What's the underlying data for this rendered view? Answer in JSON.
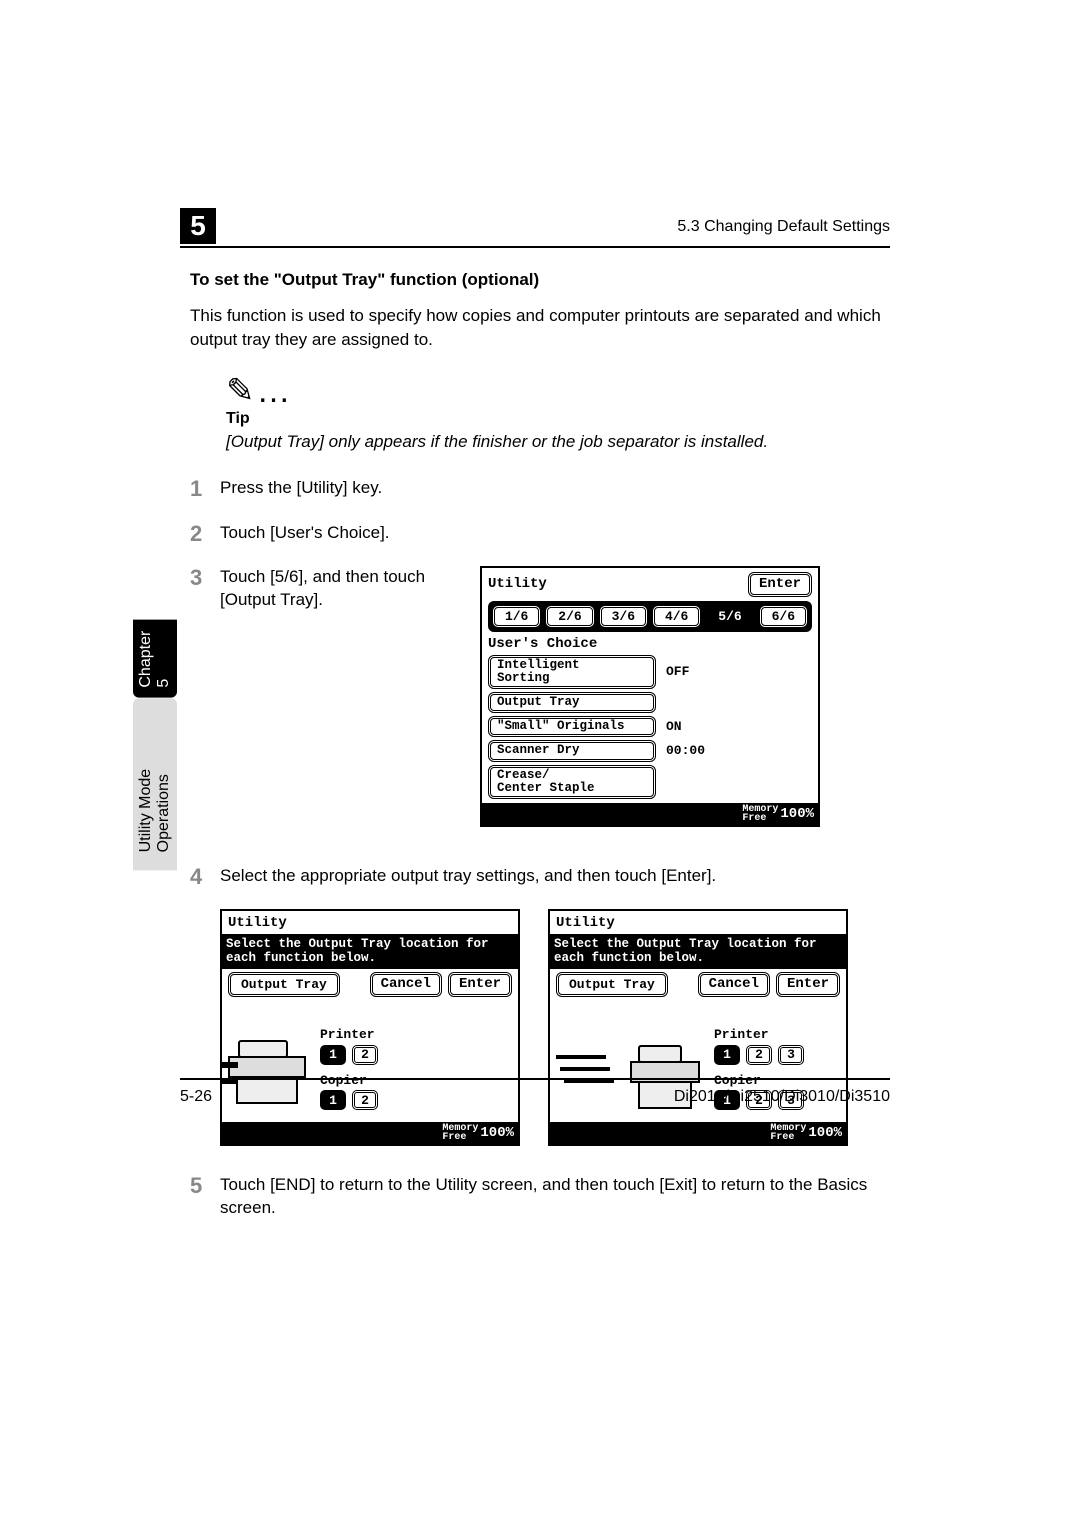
{
  "header": {
    "chapter_num": "5",
    "section": "5.3 Changing Default Settings"
  },
  "vtab": {
    "top": "Chapter 5",
    "bottom": "Utility Mode Operations"
  },
  "h2": "To set the \"Output Tray\" function (optional)",
  "intro": "This function is used to specify how copies and computer printouts are separated and which output tray they are assigned to.",
  "tip": {
    "icon": "✎…",
    "label": "Tip",
    "text": "[Output Tray] only appears if the finisher or the job separator is installed."
  },
  "steps": {
    "s1": {
      "num": "1",
      "text": "Press the [Utility] key."
    },
    "s2": {
      "num": "2",
      "text": "Touch [User's Choice]."
    },
    "s3": {
      "num": "3",
      "text": "Touch [5/6], and then touch [Output Tray]."
    },
    "s4": {
      "num": "4",
      "text": "Select the appropriate output tray settings, and then touch [Enter]."
    },
    "s5": {
      "num": "5",
      "text": "Touch [END] to return to the Utility screen, and then touch [Exit] to return to the Basics screen."
    }
  },
  "lcd1": {
    "title": "Utility",
    "enter": "Enter",
    "tabs": [
      "1/6",
      "2/6",
      "3/6",
      "4/6",
      "5/6",
      "6/6"
    ],
    "selected_tab_index": 4,
    "uc_label": "User's Choice",
    "options": [
      {
        "label": "Intelligent\nSorting",
        "value": "OFF"
      },
      {
        "label": "Output Tray",
        "value": ""
      },
      {
        "label": "\"Small\" Originals",
        "value": "ON"
      },
      {
        "label": "Scanner Dry",
        "value": "00:00"
      },
      {
        "label": "Crease/\nCenter Staple",
        "value": ""
      }
    ],
    "memory_label": "Memory\nFree",
    "memory_value": "100%"
  },
  "lcd2": {
    "title": "Utility",
    "bar": "Select the Output Tray location for each function below.",
    "ot_label": "Output Tray",
    "cancel": "Cancel",
    "enter": "Enter",
    "printer_label": "Printer",
    "copier_label": "Copier",
    "printer_nums": [
      "1",
      "2"
    ],
    "copier_nums": [
      "1",
      "2"
    ],
    "printer_selected": 0,
    "copier_selected": 0,
    "memory_label": "Memory\nFree",
    "memory_value": "100%"
  },
  "lcd3": {
    "title": "Utility",
    "bar": "Select the Output Tray location for each function below.",
    "ot_label": "Output Tray",
    "cancel": "Cancel",
    "enter": "Enter",
    "printer_label": "Printer",
    "copier_label": "Copier",
    "printer_nums": [
      "1",
      "2",
      "3"
    ],
    "copier_nums": [
      "1",
      "2",
      "3"
    ],
    "printer_selected": 0,
    "copier_selected": 0,
    "memory_label": "Memory\nFree",
    "memory_value": "100%"
  },
  "footer": {
    "page": "5-26",
    "model": "Di2010/Di2510/Di3010/Di3510"
  }
}
